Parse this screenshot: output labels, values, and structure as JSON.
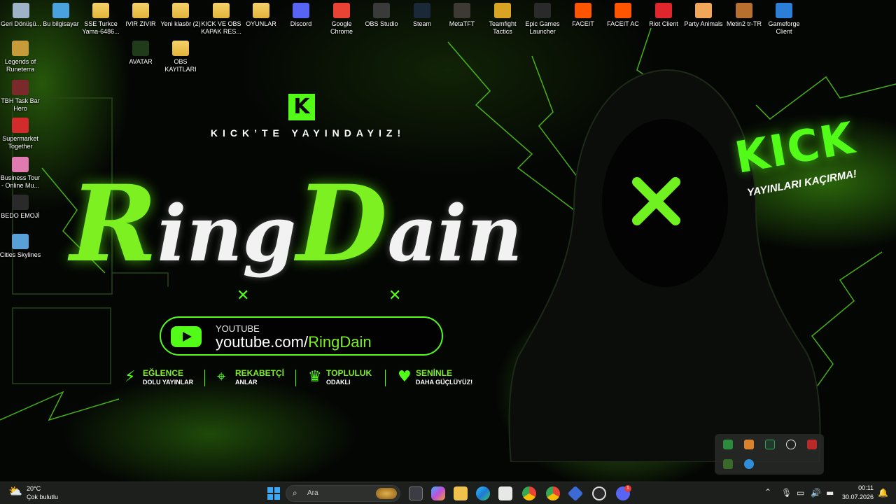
{
  "desktop": {
    "top_row": [
      {
        "label": "Geri Dönüşü...",
        "icon": "recycle-bin-icon",
        "color": "#9fb3c8"
      },
      {
        "label": "Bu bilgisayar",
        "icon": "this-pc-icon",
        "color": "#4aa3df"
      },
      {
        "label": "SSE Turkce Yama-6486...",
        "icon": "folder-icon",
        "color": "#f0c24d"
      },
      {
        "label": "IVIR ZIVIR",
        "icon": "folder-icon",
        "color": "#f0c24d"
      },
      {
        "label": "Yeni klasör (2)",
        "icon": "folder-icon",
        "color": "#f0c24d"
      },
      {
        "label": "KICK VE OBS KAPAK RES...",
        "icon": "folder-icon",
        "color": "#f0c24d"
      },
      {
        "label": "OYUNLAR",
        "icon": "folder-icon",
        "color": "#f0c24d"
      },
      {
        "label": "Discord",
        "icon": "discord-icon",
        "color": "#5865f2"
      },
      {
        "label": "Google Chrome",
        "icon": "chrome-icon",
        "color": "#e94335"
      },
      {
        "label": "OBS Studio",
        "icon": "obs-icon",
        "color": "#3a3a3a"
      },
      {
        "label": "Steam",
        "icon": "steam-icon",
        "color": "#1b2838"
      },
      {
        "label": "MetaTFT",
        "icon": "metatft-icon",
        "color": "#3d3a34"
      },
      {
        "label": "Teamfight Tactics",
        "icon": "tft-icon",
        "color": "#d9a323"
      },
      {
        "label": "Epic Games Launcher",
        "icon": "epic-games-icon",
        "color": "#2a2a2a"
      },
      {
        "label": "FACEIT",
        "icon": "faceit-icon",
        "color": "#ff5500"
      },
      {
        "label": "FACEIT AC",
        "icon": "faceit-ac-icon",
        "color": "#ff5500"
      },
      {
        "label": "Riot Client",
        "icon": "riot-client-icon",
        "color": "#e0262d"
      },
      {
        "label": "Party Animals",
        "icon": "party-animals-icon",
        "color": "#f2a65a"
      },
      {
        "label": "Metin2 tr-TR",
        "icon": "metin2-icon",
        "color": "#b8702e"
      },
      {
        "label": "Gameforge Client",
        "icon": "gameforge-icon",
        "color": "#2b7fd6"
      }
    ],
    "second_row": [
      {
        "label": "AVATAR",
        "icon": "avatar-icon",
        "color": "#1f3b1a"
      },
      {
        "label": "OBS KAYITLARI",
        "icon": "folder-icon",
        "color": "#f0c24d"
      }
    ],
    "left_column": [
      {
        "label": "Legends of Runeterra",
        "icon": "runeterra-icon",
        "color": "#c79a3a"
      },
      {
        "label": "TBH Task Bar Hero",
        "icon": "tbh-icon",
        "color": "#7a2a2a"
      },
      {
        "label": "Supermarket Together",
        "icon": "supermarket-together-icon",
        "color": "#d12b2b"
      },
      {
        "label": "Business Tour - Online Mu...",
        "icon": "business-tour-icon",
        "color": "#e07ab0"
      },
      {
        "label": "BEDO EMOJİ",
        "icon": "bedo-emoji-icon",
        "color": "#2a2a2a"
      },
      {
        "label": "Cities Skylines",
        "icon": "cities-skylines-icon",
        "color": "#5aa0d8"
      }
    ]
  },
  "wallpaper": {
    "kick_letter": "K",
    "tagline": "KICK’TE YAYINDAYIZ!",
    "brand_part1": "Ring",
    "brand_part2": "Dain",
    "youtube_label": "YOUTUBE",
    "youtube_url_prefix": "youtube.com/",
    "youtube_url_name": "RingDain",
    "features": [
      {
        "icon": "lightning-icon",
        "title": "EĞLENCE",
        "subtitle": "DOLU YAYINLAR"
      },
      {
        "icon": "crosshair-icon",
        "title": "REKABETÇİ",
        "subtitle": "ANLAR"
      },
      {
        "icon": "crown-icon",
        "title": "TOPLULUK",
        "subtitle": "ODAKLI"
      },
      {
        "icon": "heart-icon",
        "title": "SENİNLE",
        "subtitle": "DAHA GÜÇLÜYÜZ!"
      }
    ],
    "kick_big": "KICK",
    "kick_slogan": "YAYINLARI KAÇIRMA!",
    "accent": "#53fc18"
  },
  "taskbar": {
    "weather_temp": "20°C",
    "weather_condition": "Çok bulutlu",
    "search_placeholder": "Ara",
    "apps": [
      {
        "name": "start-button",
        "icon": "windows-icon"
      },
      {
        "name": "taskbar-file-explorer",
        "icon": "file-explorer-icon"
      },
      {
        "name": "taskbar-copilot",
        "icon": "copilot-icon"
      },
      {
        "name": "taskbar-folder",
        "icon": "folder-icon"
      },
      {
        "name": "taskbar-edge",
        "icon": "edge-icon"
      },
      {
        "name": "taskbar-store",
        "icon": "store-icon"
      },
      {
        "name": "taskbar-chrome",
        "icon": "chrome-icon"
      },
      {
        "name": "taskbar-chrome-profile",
        "icon": "chrome-icon"
      },
      {
        "name": "taskbar-metatft",
        "icon": "metatft-icon"
      },
      {
        "name": "taskbar-obs",
        "icon": "obs-icon"
      },
      {
        "name": "taskbar-discord",
        "icon": "discord-icon"
      }
    ],
    "discord_badge": "1",
    "time": "00:11",
    "date": "30.07.2026"
  }
}
